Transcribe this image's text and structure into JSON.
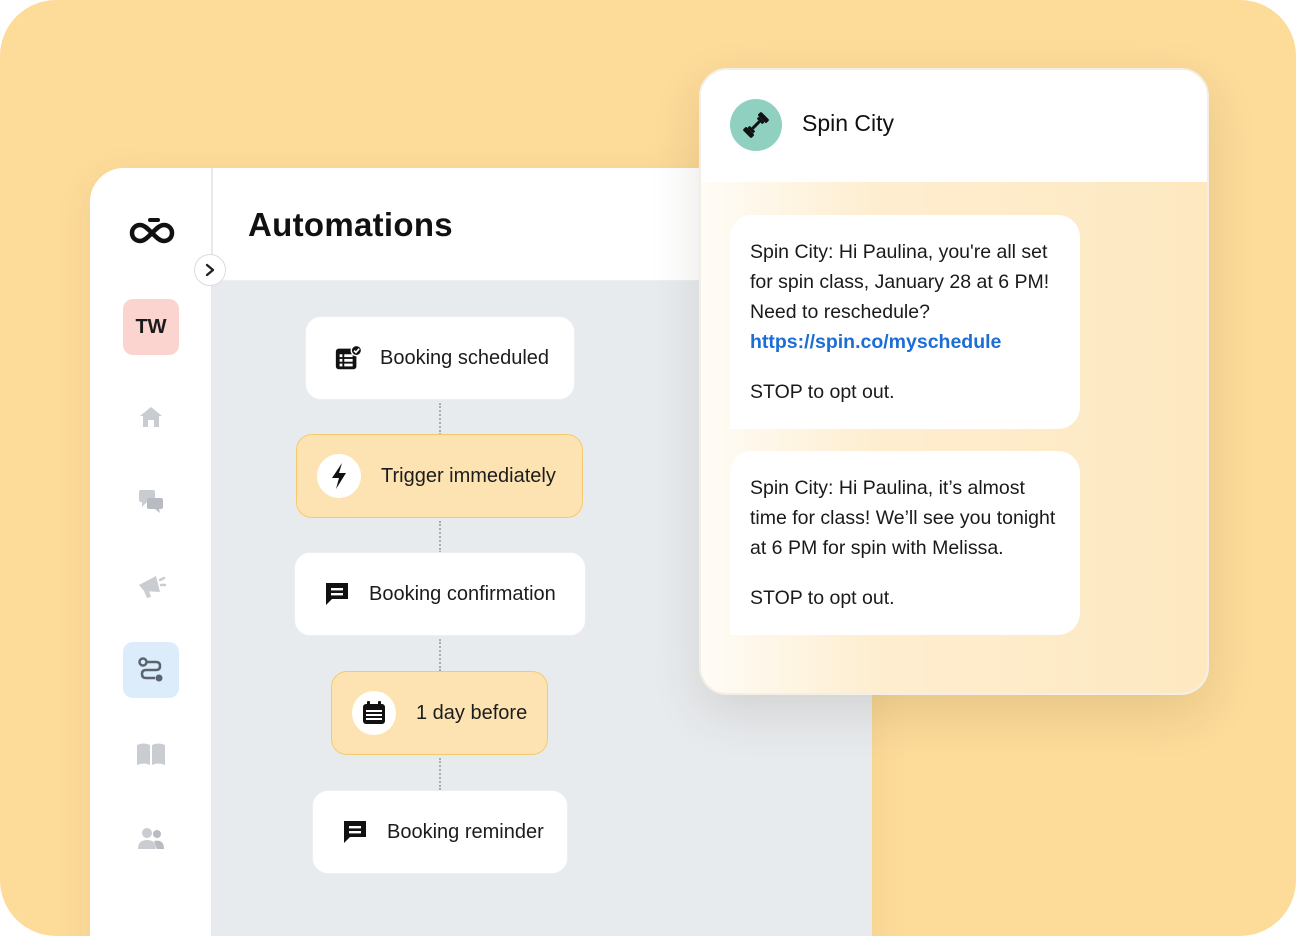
{
  "app": {
    "title": "Automations",
    "avatar_initials": "TW",
    "sidebar_icons": [
      "logo-icon",
      "home-icon",
      "conversations-icon",
      "megaphone-icon",
      "automations-icon",
      "book-icon",
      "contacts-icon"
    ],
    "active_item": "automations-icon"
  },
  "flow": {
    "nodes": [
      {
        "label": "Booking scheduled",
        "icon": "calendar-check-icon",
        "style": "white"
      },
      {
        "label": "Trigger immediately",
        "icon": "lightning-icon",
        "style": "yellow"
      },
      {
        "label": "Booking confirmation",
        "icon": "message-icon",
        "style": "white"
      },
      {
        "label": "1 day before",
        "icon": "calendar-icon",
        "style": "yellow"
      },
      {
        "label": "Booking reminder",
        "icon": "message-icon",
        "style": "white"
      }
    ]
  },
  "chat": {
    "contact_name": "Spin City",
    "contact_icon": "dumbbell-icon",
    "messages": [
      {
        "text": "Spin City: Hi Paulina, you're all set for spin class, January 28 at 6 PM! Need to reschedule? ",
        "link": "https://spin.co/myschedule",
        "footer": "STOP to opt out."
      },
      {
        "text": "Spin City: Hi Paulina, it’s almost time for class! We’ll see you tonight at 6 PM for spin with Melissa.",
        "footer": "STOP to opt out."
      }
    ]
  },
  "colors": {
    "background": "#fddb99",
    "link": "#1c6ed6",
    "yellow_node": "#fde3b2",
    "avatar_bg": "#fbd3cf",
    "active_nav": "#dcecfb",
    "contact_avatar": "#8fd0c0"
  }
}
